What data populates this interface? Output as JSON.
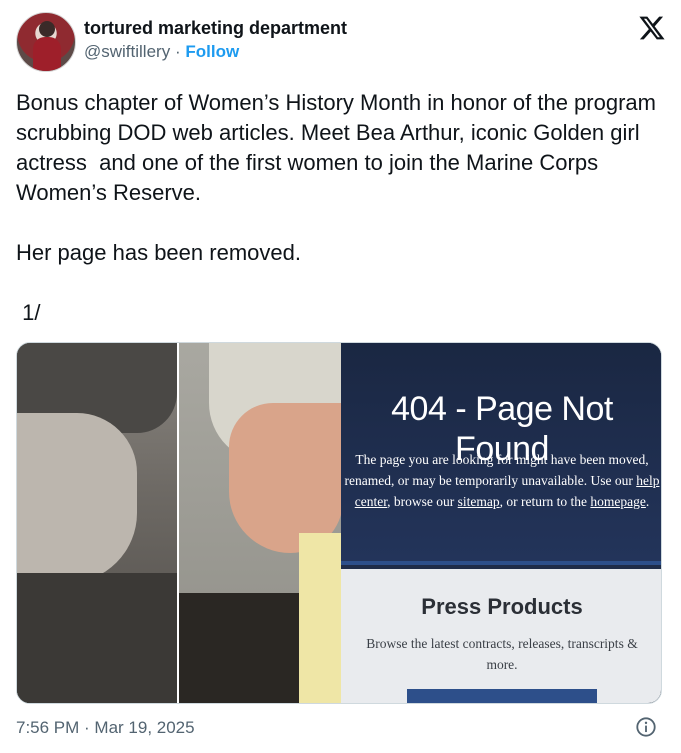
{
  "header": {
    "display_name": "tortured marketing department",
    "handle": "@swiftillery",
    "separator": "·",
    "follow_label": "Follow",
    "logo_icon": "x-logo-icon"
  },
  "tweet": {
    "text": "Bonus chapter of Women’s History Month in honor of the program scrubbing DOD web articles. Meet Bea Arthur, iconic Golden girl actress  and one of the first women to join the Marine Corps Women’s Reserve.\n\nHer page has been removed.\n\n 1/"
  },
  "media": {
    "error_title": "404 - Page Not Found",
    "error_msg_part1": "The page you are looking for might have been moved, renamed, or may be temporarily unavailable. Use our ",
    "help_link": "help center",
    "error_msg_part2": ", browse our ",
    "sitemap_link": "sitemap",
    "error_msg_part3": ", or return to the ",
    "homepage_link": "homepage",
    "error_msg_part4": ".",
    "section_title": "Press Products",
    "section_desc": "Browse the latest contracts, releases, transcripts & more."
  },
  "footer": {
    "timestamp": "7:56 PM · Mar 19, 2025",
    "info_icon": "info-icon"
  },
  "colors": {
    "follow_blue": "#1d9bf0",
    "text_primary": "#0f1419",
    "text_secondary": "#536471",
    "dod_navy": "#1f2c48"
  }
}
